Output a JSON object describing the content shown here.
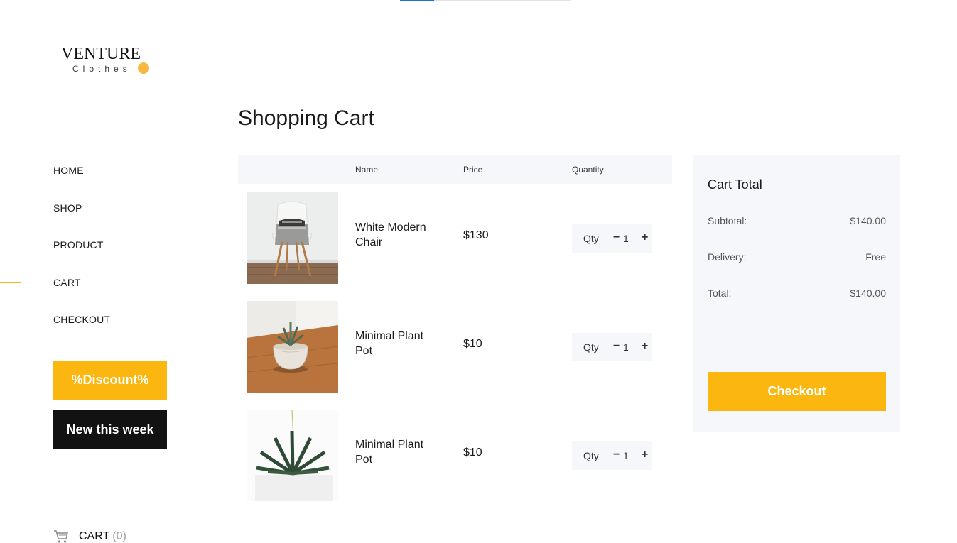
{
  "top_progress": {
    "percent": 20
  },
  "logo": {
    "brand": "VENTURE",
    "sub": "Clothes",
    "dot_color": "#f7b844"
  },
  "nav": {
    "items": [
      {
        "label": "HOME",
        "active": false
      },
      {
        "label": "SHOP",
        "active": false
      },
      {
        "label": "PRODUCT",
        "active": false
      },
      {
        "label": "CART",
        "active": true
      },
      {
        "label": "CHECKOUT",
        "active": false
      }
    ]
  },
  "promo": {
    "discount_label": "%Discount%",
    "new_label": "New this week"
  },
  "cart_link": {
    "label": "CART",
    "count": "(0)",
    "icon": "cart-icon"
  },
  "page": {
    "title": "Shopping Cart"
  },
  "table": {
    "headers": {
      "name": "Name",
      "price": "Price",
      "quantity": "Quantity"
    },
    "rows": [
      {
        "name": "White Modern Chair",
        "price": "$130",
        "qty_label": "Qty",
        "qty": "1",
        "image": "chair-image"
      },
      {
        "name": "Minimal Plant Pot",
        "price": "$10",
        "qty_label": "Qty",
        "qty": "1",
        "image": "plant-pot-image"
      },
      {
        "name": "Minimal Plant Pot",
        "price": "$10",
        "qty_label": "Qty",
        "qty": "1",
        "image": "succulent-image"
      }
    ]
  },
  "summary": {
    "title": "Cart Total",
    "subtotal_label": "Subtotal:",
    "subtotal": "$140.00",
    "delivery_label": "Delivery:",
    "delivery": "Free",
    "total_label": "Total:",
    "total": "$140.00",
    "checkout_label": "Checkout"
  },
  "colors": {
    "accent": "#fbb710",
    "dark": "#131212",
    "panel": "#f5f7fa",
    "progress": "#1a73c7"
  }
}
